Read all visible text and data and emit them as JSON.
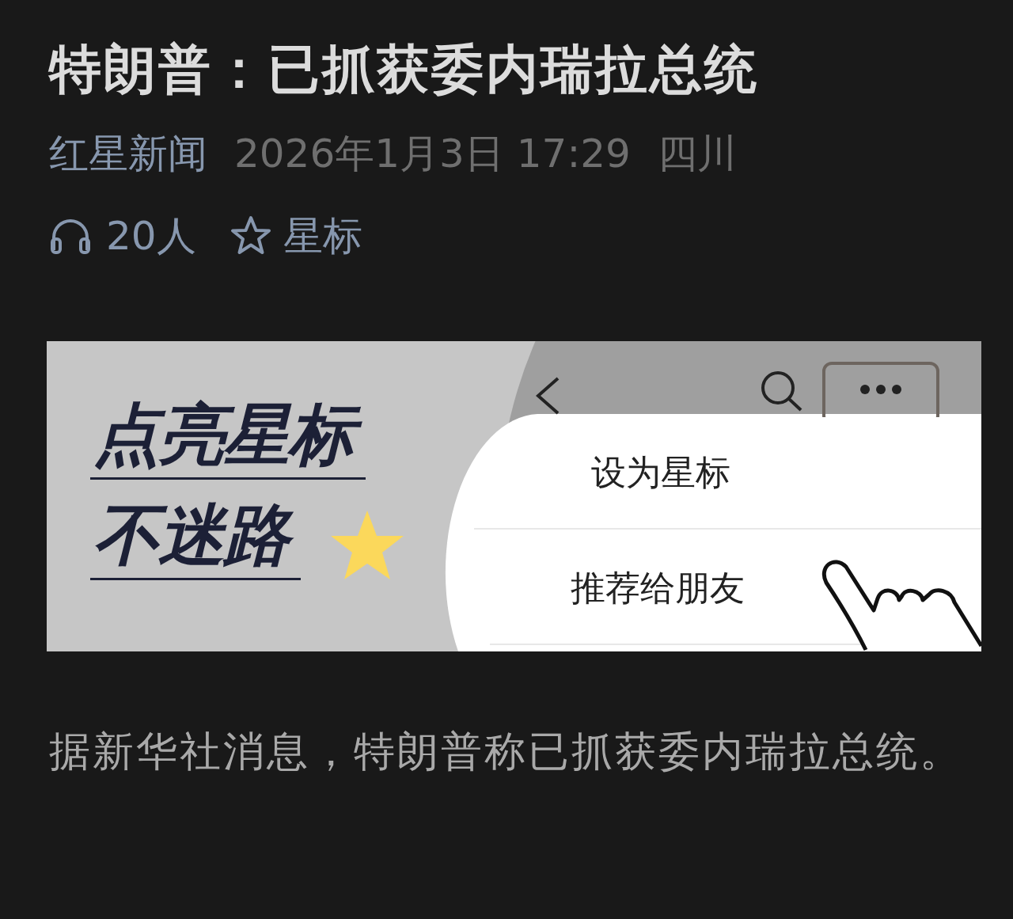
{
  "title": "特朗普：已抓获委内瑞拉总统",
  "meta": {
    "source": "红星新闻",
    "date": "2026年1月3日 17:29",
    "location": "四川"
  },
  "stats": {
    "listeners": "20人",
    "star_label": "星标"
  },
  "banner": {
    "headline_lines": [
      "点亮星标",
      "不迷路"
    ],
    "menu_items": [
      "设为星标",
      "推荐给朋友"
    ]
  },
  "body": "据新华社消息，特朗普称已抓获委内瑞拉总统。"
}
